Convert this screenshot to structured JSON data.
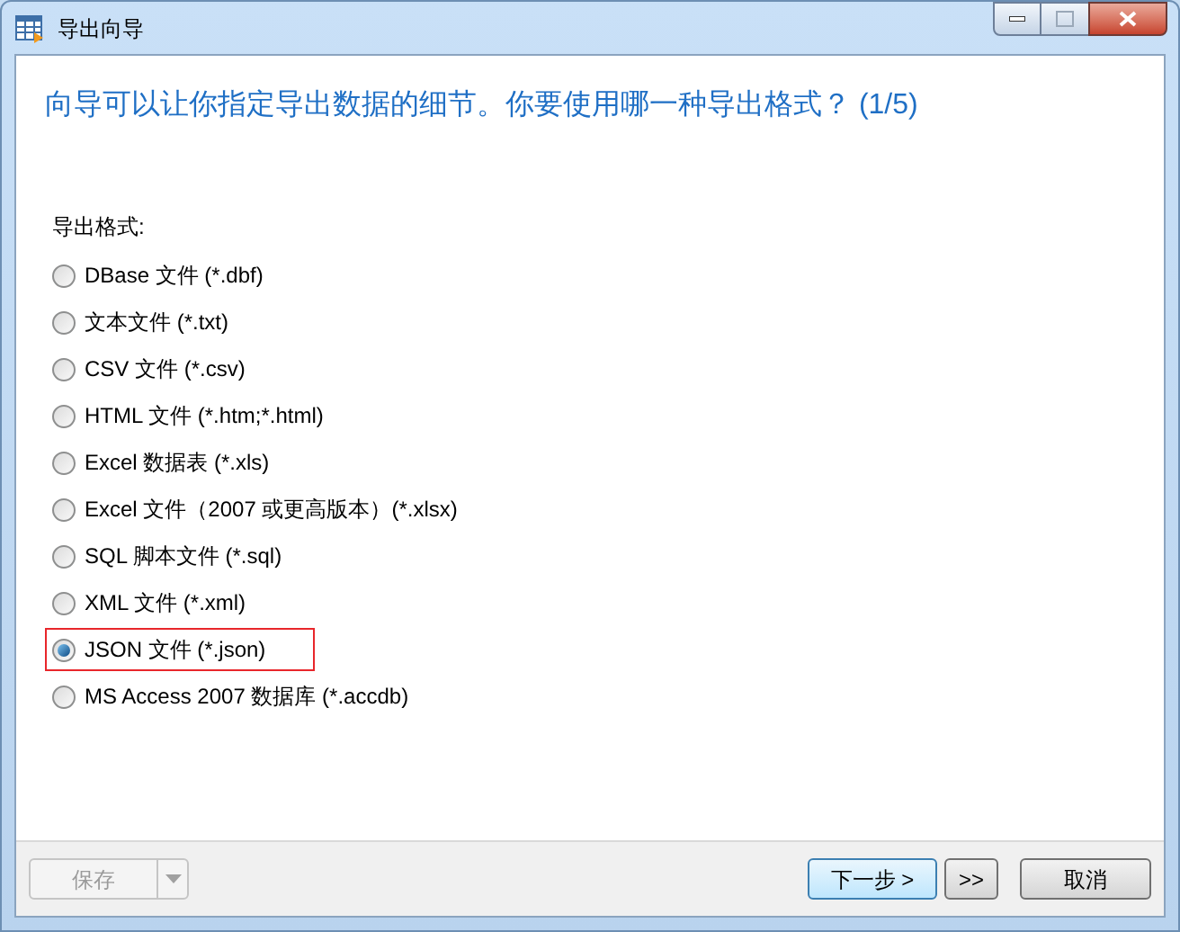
{
  "window": {
    "title": "导出向导"
  },
  "heading": "向导可以让你指定导出数据的细节。你要使用哪一种导出格式？ (1/5)",
  "format_label": "导出格式:",
  "formats": [
    {
      "label": "DBase 文件 (*.dbf)",
      "selected": false,
      "highlighted": false
    },
    {
      "label": "文本文件 (*.txt)",
      "selected": false,
      "highlighted": false
    },
    {
      "label": "CSV 文件 (*.csv)",
      "selected": false,
      "highlighted": false
    },
    {
      "label": "HTML 文件 (*.htm;*.html)",
      "selected": false,
      "highlighted": false
    },
    {
      "label": "Excel 数据表 (*.xls)",
      "selected": false,
      "highlighted": false
    },
    {
      "label": "Excel 文件（2007 或更高版本）(*.xlsx)",
      "selected": false,
      "highlighted": false
    },
    {
      "label": "SQL 脚本文件 (*.sql)",
      "selected": false,
      "highlighted": false
    },
    {
      "label": "XML 文件 (*.xml)",
      "selected": false,
      "highlighted": false
    },
    {
      "label": "JSON 文件 (*.json)",
      "selected": true,
      "highlighted": true
    },
    {
      "label": "MS Access 2007 数据库 (*.accdb)",
      "selected": false,
      "highlighted": false
    }
  ],
  "save_button": {
    "label": "保存",
    "disabled": true
  },
  "buttons": [
    {
      "label": "下一步 >",
      "kind": "default"
    },
    {
      "label": ">>",
      "kind": "small"
    },
    {
      "label": "取消",
      "kind": "normal"
    }
  ]
}
